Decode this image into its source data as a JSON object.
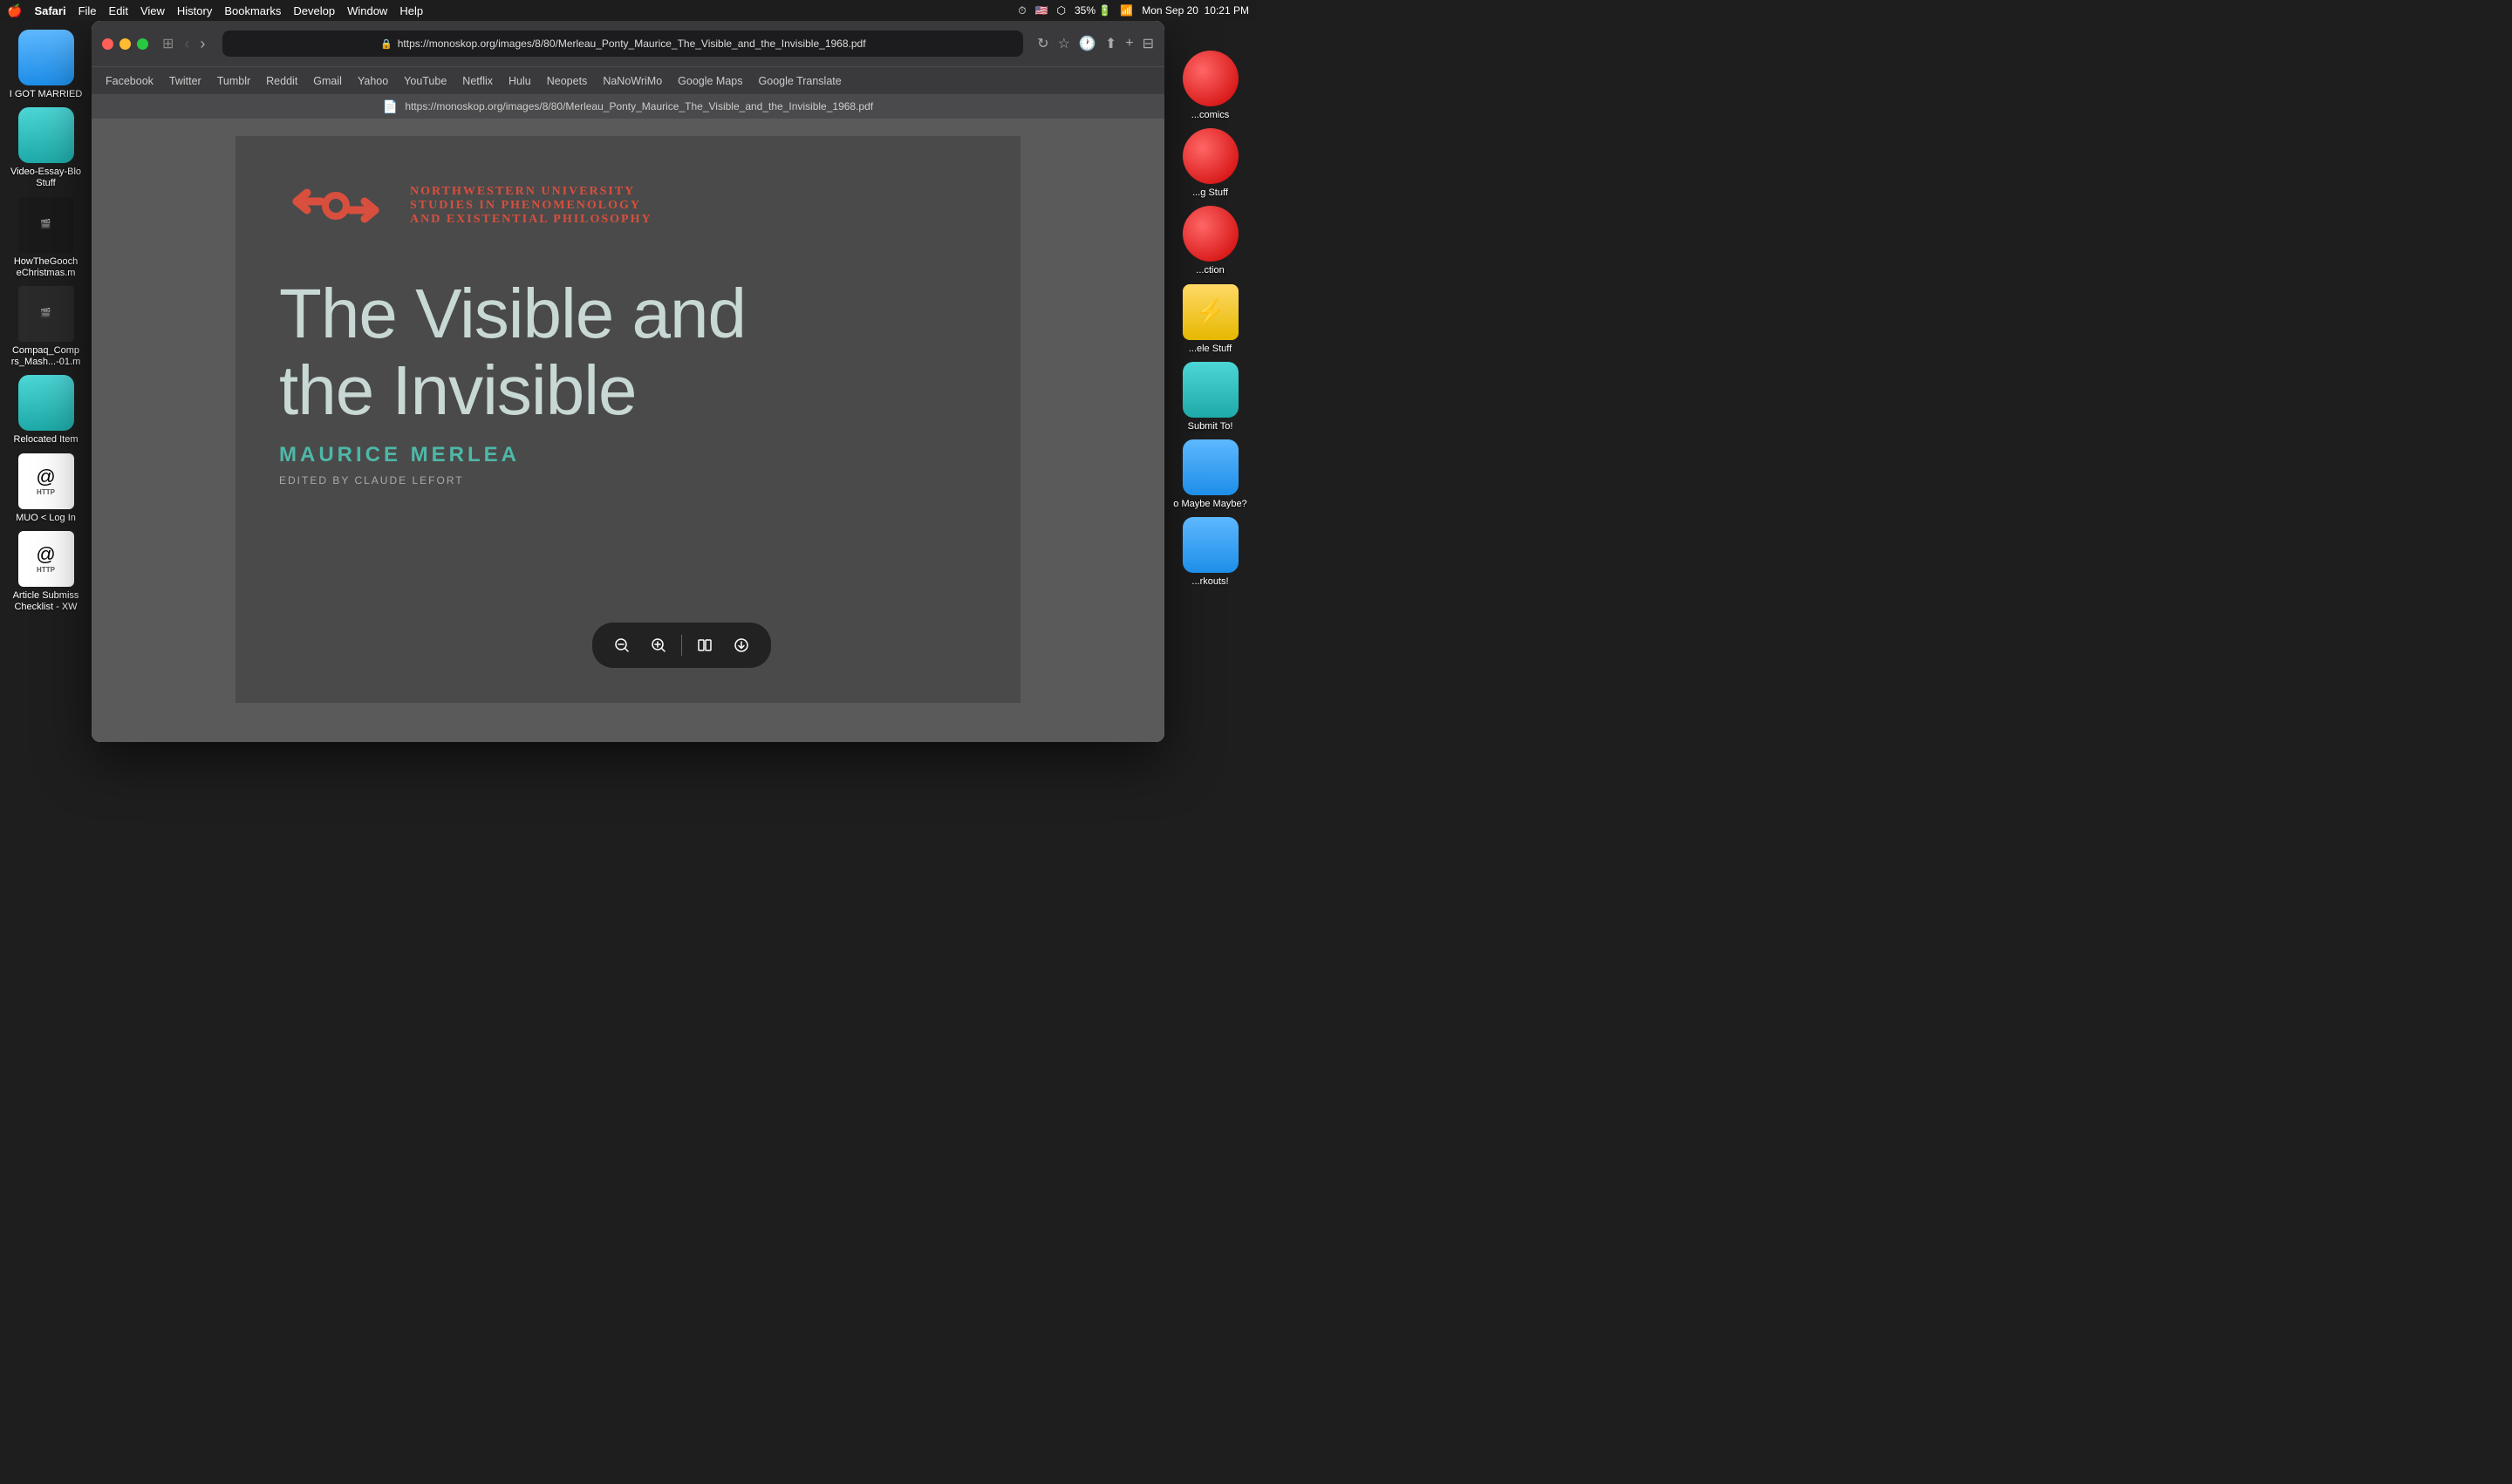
{
  "menubar": {
    "apple": "⌘",
    "app": "Safari",
    "items": [
      "Safari",
      "File",
      "Edit",
      "View",
      "History",
      "Bookmarks",
      "Develop",
      "Window",
      "Help"
    ],
    "right_items": [
      "🕐",
      "🌐",
      "🎵",
      "35%",
      "🔋",
      "📶",
      "Mon Sep 20",
      "10:21 PM"
    ]
  },
  "browser": {
    "url": "https://monoskop.org/images/8/80/Merleau_Ponty_Maurice_The_Visible_and_the_Invisible_1968.pdf",
    "bookmarks": [
      "Facebook",
      "Twitter",
      "Tumblr",
      "Reddit",
      "Gmail",
      "Yahoo",
      "YouTube",
      "Netflix",
      "Hulu",
      "Neopets",
      "NaNoWriMo",
      "Google Maps",
      "Google Translate"
    ]
  },
  "pdf": {
    "title_line1": "The Visible and",
    "title_line2": "the Invisible",
    "author": "MAURICE MERLEA",
    "editor": "EDITED BY CLAUDE LEFORT",
    "nu_line1": "NORTHWESTERN UNIVERSITY",
    "nu_line2": "STUDIES IN PHENOMENOLOGY",
    "nu_line3": "AND EXISTENTIAL PHILOSOPHY"
  },
  "desktop": {
    "left_icons": [
      {
        "label": "I GOT MARRIED",
        "type": "folder-blue"
      },
      {
        "label": "Video-Essay-Blo Stuff",
        "type": "folder-teal"
      },
      {
        "label": "HowTheGooch eChristmas.m",
        "type": "video-dark"
      },
      {
        "label": "Compaq_Comp rs_Mash...-01.m",
        "type": "video-dark2"
      },
      {
        "label": "Relocated Item",
        "type": "folder-blue2"
      },
      {
        "label": "MUO < Log In",
        "type": "http-file"
      },
      {
        "label": "Article Submiss Checklist - XW",
        "type": "http-file2"
      }
    ],
    "right_icons": [
      {
        "label": "...comics",
        "type": "red-circle"
      },
      {
        "label": "...g Stuff",
        "type": "red-circle"
      },
      {
        "label": "...ction",
        "type": "red-circle"
      },
      {
        "label": "...ele Stuff",
        "type": "red-circle2"
      },
      {
        "label": "Submit To!",
        "type": "folder-teal2"
      },
      {
        "label": "o Maybe Maybe?",
        "type": "folder-teal3"
      },
      {
        "label": "...rkouts!",
        "type": "folder-teal4"
      }
    ]
  },
  "pdf_toolbar": {
    "zoom_out": "−",
    "zoom_in": "+",
    "page_view": "⊞",
    "download": "↓"
  }
}
